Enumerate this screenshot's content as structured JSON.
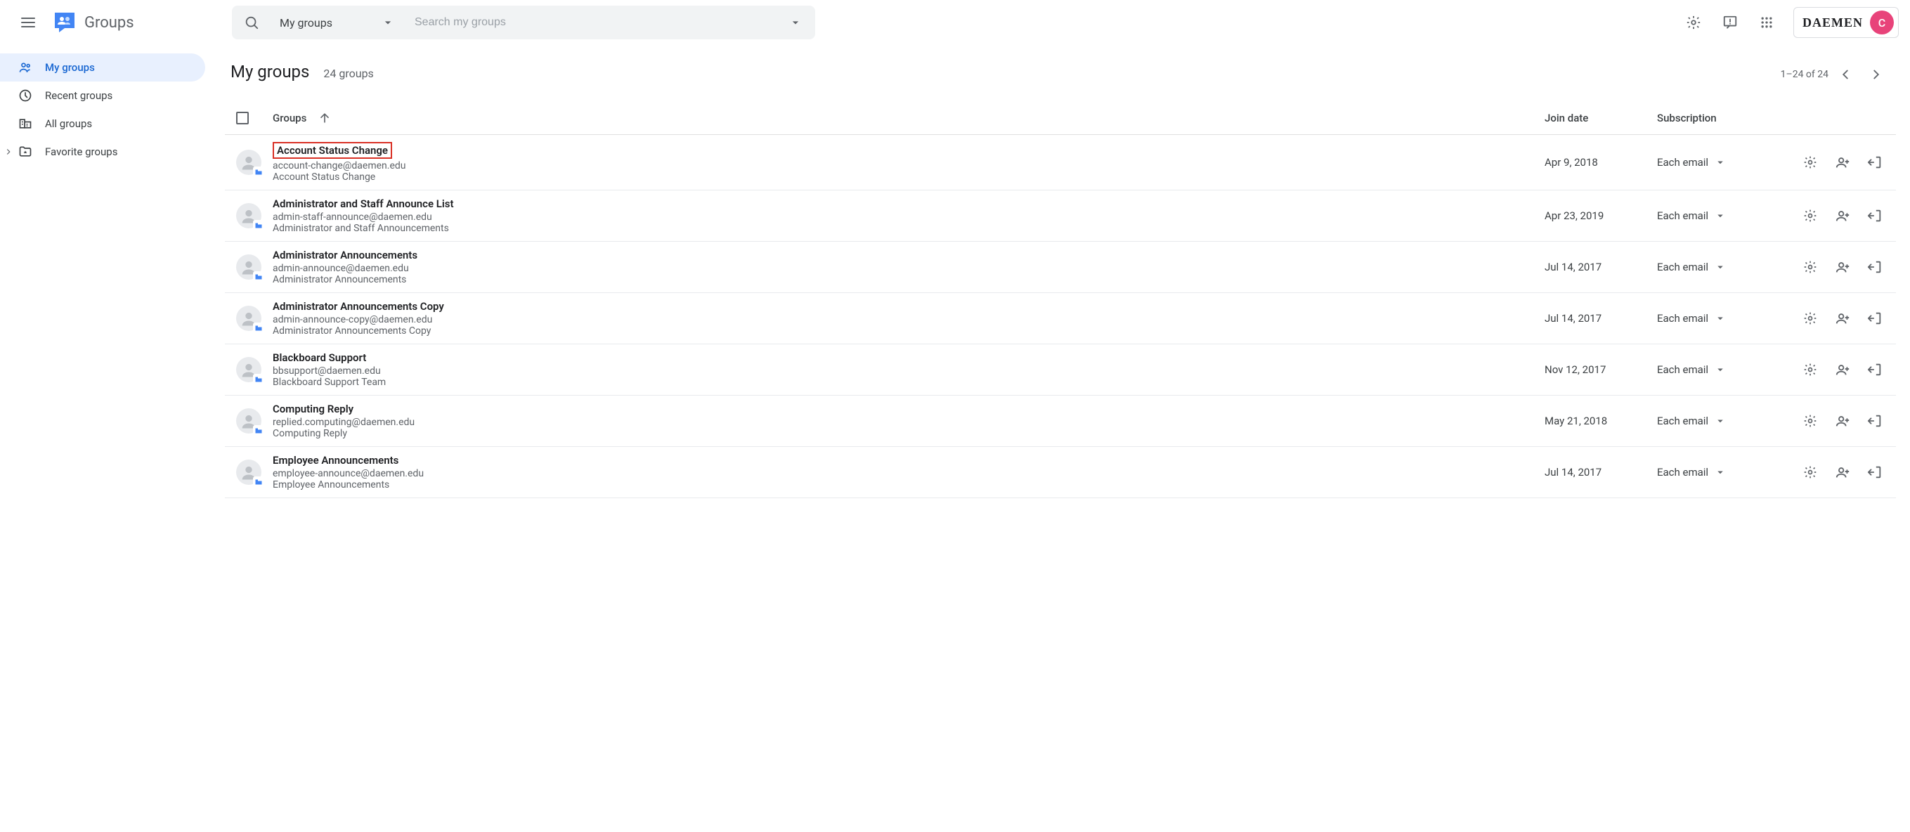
{
  "app": {
    "name": "Groups"
  },
  "brand": {
    "org": "DAEMEN",
    "avatar_initial": "C"
  },
  "search": {
    "scope": "My groups",
    "placeholder": "Search my groups"
  },
  "sidebar": {
    "items": [
      {
        "label": "My groups",
        "icon": "people",
        "active": true
      },
      {
        "label": "Recent groups",
        "icon": "clock",
        "active": false
      },
      {
        "label": "All groups",
        "icon": "domain",
        "active": false
      },
      {
        "label": "Favorite groups",
        "icon": "star-folder",
        "active": false,
        "expandable": true
      }
    ]
  },
  "page": {
    "title": "My groups",
    "count_label": "24 groups",
    "pager_label": "1–24 of 24"
  },
  "columns": {
    "groups": "Groups",
    "join": "Join date",
    "subscription": "Subscription"
  },
  "groups": [
    {
      "name": "Account Status Change",
      "email": "account-change@daemen.edu",
      "desc": "Account Status Change",
      "join": "Apr 9, 2018",
      "sub": "Each email",
      "highlight": true
    },
    {
      "name": "Administrator and Staff Announce List",
      "email": "admin-staff-announce@daemen.edu",
      "desc": "Administrator and Staff Announcements",
      "join": "Apr 23, 2019",
      "sub": "Each email"
    },
    {
      "name": "Administrator Announcements",
      "email": "admin-announce@daemen.edu",
      "desc": "Administrator Announcements",
      "join": "Jul 14, 2017",
      "sub": "Each email"
    },
    {
      "name": "Administrator Announcements Copy",
      "email": "admin-announce-copy@daemen.edu",
      "desc": "Administrator Announcements Copy",
      "join": "Jul 14, 2017",
      "sub": "Each email"
    },
    {
      "name": "Blackboard Support",
      "email": "bbsupport@daemen.edu",
      "desc": "Blackboard Support Team",
      "join": "Nov 12, 2017",
      "sub": "Each email"
    },
    {
      "name": "Computing Reply",
      "email": "replied.computing@daemen.edu",
      "desc": "Computing Reply",
      "join": "May 21, 2018",
      "sub": "Each email"
    },
    {
      "name": "Employee Announcements",
      "email": "employee-announce@daemen.edu",
      "desc": "Employee Announcements",
      "join": "Jul 14, 2017",
      "sub": "Each email"
    }
  ]
}
